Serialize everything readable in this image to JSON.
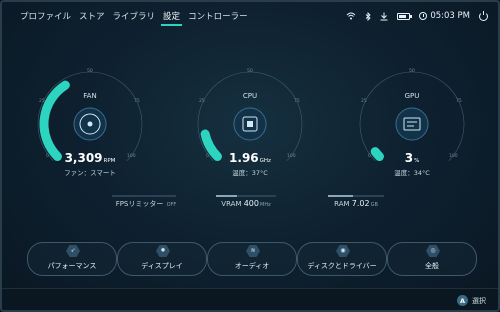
{
  "nav": {
    "items": [
      "プロファイル",
      "ストア",
      "ライブラリ",
      "設定",
      "コントローラー"
    ],
    "active_index": 3
  },
  "status": {
    "time": "05:03 PM",
    "wifi_icon": "wifi-icon",
    "bluetooth_icon": "bluetooth-icon",
    "download_icon": "download-icon",
    "battery_icon": "battery-icon",
    "power_icon": "power-icon"
  },
  "gauges": {
    "fan": {
      "label": "FAN",
      "value": "3,309",
      "unit": "RPM",
      "sub": "ファン：スマート",
      "level": 0.38
    },
    "cpu": {
      "label": "CPU",
      "value": "1.96",
      "unit": "GHz",
      "sub": "温度：37°C",
      "level": 0.12
    },
    "gpu": {
      "label": "GPU",
      "value": "3",
      "unit": "%",
      "sub": "温度：34°C",
      "level": 0.03
    },
    "ticks": [
      "0",
      "25",
      "50",
      "75",
      "100"
    ]
  },
  "metrics": {
    "fps": {
      "label": "FPSリミッター",
      "value": "OFF"
    },
    "vram": {
      "label": "VRAM",
      "value": "400",
      "unit": "MHz",
      "level": 0.35
    },
    "ram": {
      "label": "RAM",
      "value": "7.02",
      "unit": "GB",
      "level": 0.45
    }
  },
  "buttons": [
    {
      "label": "パフォーマンス",
      "icon": "rocket-icon",
      "glyph": "➶"
    },
    {
      "label": "ディスプレイ",
      "icon": "brightness-icon",
      "glyph": "✹"
    },
    {
      "label": "オーディオ",
      "icon": "audio-wave-icon",
      "glyph": "≋"
    },
    {
      "label": "ディスクとドライバー",
      "icon": "disk-icon",
      "glyph": "◉"
    },
    {
      "label": "全般",
      "icon": "settings-icon",
      "glyph": "◎"
    }
  ],
  "hint": {
    "key": "A",
    "label": "選択"
  },
  "colors": {
    "accent": "#2dd4bf",
    "ring": "#3f5d6f",
    "background": "#0e2130"
  }
}
